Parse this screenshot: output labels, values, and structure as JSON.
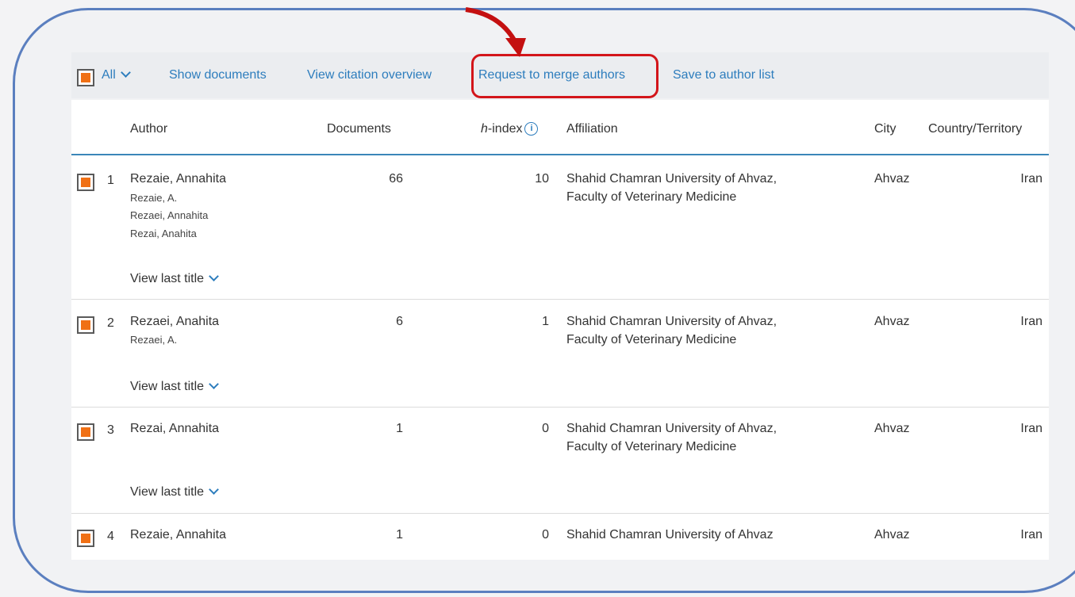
{
  "toolbar": {
    "all_label": "All",
    "show_documents": "Show documents",
    "view_citation_overview": "View citation overview",
    "request_merge": "Request to merge authors",
    "save_to_list": "Save to author list"
  },
  "columns": {
    "author": "Author",
    "documents": "Documents",
    "h_index_h": "h",
    "h_index_rest": "-index",
    "affiliation": "Affiliation",
    "city": "City",
    "country": "Country/Territory"
  },
  "rows": [
    {
      "num": "1",
      "name": "Rezaie, Annahita",
      "variants": [
        "Rezaie, A.",
        "Rezaei, Annahita",
        "Rezai, Anahita"
      ],
      "documents": "66",
      "h_index": "10",
      "affiliation_line1": "Shahid Chamran University of Ahvaz,",
      "affiliation_line2": "Faculty of Veterinary Medicine",
      "city": "Ahvaz",
      "country": "Iran",
      "view_last_title": "View last title"
    },
    {
      "num": "2",
      "name": "Rezaei, Anahita",
      "variants": [
        "Rezaei, A."
      ],
      "documents": "6",
      "h_index": "1",
      "affiliation_line1": "Shahid Chamran University of Ahvaz,",
      "affiliation_line2": "Faculty of Veterinary Medicine",
      "city": "Ahvaz",
      "country": "Iran",
      "view_last_title": "View last title"
    },
    {
      "num": "3",
      "name": "Rezai, Annahita",
      "variants": [],
      "documents": "1",
      "h_index": "0",
      "affiliation_line1": "Shahid Chamran University of Ahvaz,",
      "affiliation_line2": "Faculty of Veterinary Medicine",
      "city": "Ahvaz",
      "country": "Iran",
      "view_last_title": "View last title"
    },
    {
      "num": "4",
      "name": "Rezaie, Annahita",
      "variants": [],
      "documents": "1",
      "h_index": "0",
      "affiliation_line1": "Shahid Chamran University of Ahvaz",
      "affiliation_line2": "",
      "city": "Ahvaz",
      "country": "Iran"
    }
  ],
  "colors": {
    "accent": "#2d7dbd",
    "checkbox": "#f07015",
    "highlight": "#d3151a",
    "frame": "#5b7fbf"
  }
}
